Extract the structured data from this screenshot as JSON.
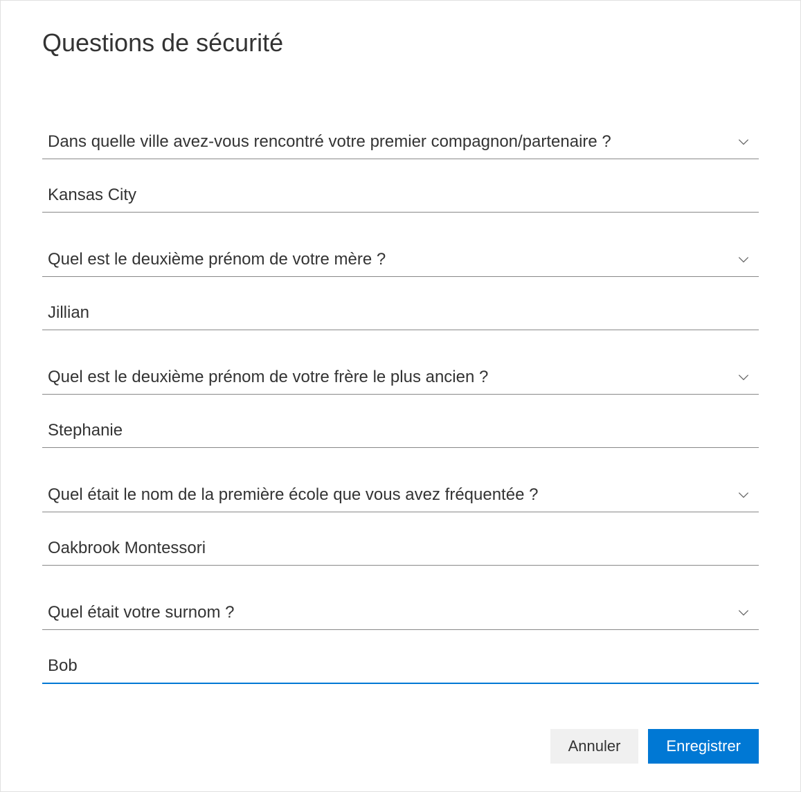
{
  "title": "Questions de sécurité",
  "questions": [
    {
      "question": "Dans quelle ville avez-vous rencontré votre premier compagnon/partenaire ?",
      "answer": "Kansas City",
      "focused": false
    },
    {
      "question": "Quel est le deuxième prénom de votre mère ?",
      "answer": "Jillian",
      "focused": false
    },
    {
      "question": "Quel est le deuxième prénom de votre frère le plus ancien ?",
      "answer": "Stephanie",
      "focused": false
    },
    {
      "question": "Quel était le nom de la première école que vous avez fréquentée ?",
      "answer": "Oakbrook Montessori",
      "focused": false
    },
    {
      "question": "Quel était votre surnom ?",
      "answer": "Bob",
      "focused": true
    }
  ],
  "buttons": {
    "cancel": "Annuler",
    "save": "Enregistrer"
  }
}
